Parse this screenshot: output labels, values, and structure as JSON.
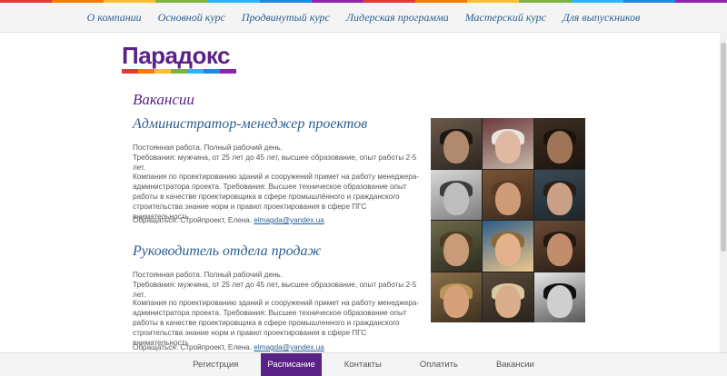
{
  "top_nav": {
    "items": [
      {
        "label": "О компании"
      },
      {
        "label": "Основной курс"
      },
      {
        "label": "Продвинутый курс"
      },
      {
        "label": "Лидерская программа"
      },
      {
        "label": "Мастерский курс"
      },
      {
        "label": "Для выпускников"
      }
    ]
  },
  "logo": {
    "text": "Парадокс",
    "colors": [
      "#e53935",
      "#f57c00",
      "#fbc02d",
      "#7cb342",
      "#29b6f6",
      "#1e88e5",
      "#8e24aa"
    ]
  },
  "rainbow_colors": [
    "#e53935",
    "#f57c00",
    "#fbc02d",
    "#7cb342",
    "#29b6f6",
    "#1e88e5",
    "#8e24aa"
  ],
  "page": {
    "title": "Вакансии"
  },
  "vacancies": [
    {
      "title": "Администратор-менеджер проектов",
      "terms_line1": "Постоянная работа. Полный рабочий день.",
      "terms_line2": "Требования: мужчина, от 25 лет до 45 лет, высшее образование, опыт работы 2-5 лет.",
      "description": "Компания по проектированию зданий и сооружений примет на работу менеджера-администратора проекта. Требования: Высшее техническое образование опыт работы в качестве проектировщика в сфере промышлённого и гражданского строительства знание норм и правил проектирования в сфере ПГС внимательность",
      "contact_prefix": "Обращаться: Стройпроект, Елена.",
      "email": "elmagda@yandex.ua"
    },
    {
      "title": "Руководитель отдела продаж",
      "terms_line1": "Постоянная работа. Полный рабочий день.",
      "terms_line2": "Требования: мужчина, от 25 лет до 45 лет, высшее образование, опыт работы 2-5 лет.",
      "description": "Компания по проектированию зданий и сооружений примет на работу менеджера-администратора проекта. Требования: Высшее техническое образование опыт работы в качестве проектировщика в сфере промышленного и гражданского строительства знание норм и правил проектирования в сфере ПГС внимательность",
      "contact_prefix": "Обращаться: Стройпроект, Елена.",
      "email": "elmagda@yandex.ua"
    }
  ],
  "bottom_nav": {
    "items": [
      {
        "label": "Регистрция",
        "active": false
      },
      {
        "label": "Расписание",
        "active": true
      },
      {
        "label": "Контакты",
        "active": false
      },
      {
        "label": "Оплатить",
        "active": false
      },
      {
        "label": "Вакансии",
        "active": false
      }
    ]
  },
  "accent_color": "#5b2286",
  "link_color": "#2a5f8f"
}
